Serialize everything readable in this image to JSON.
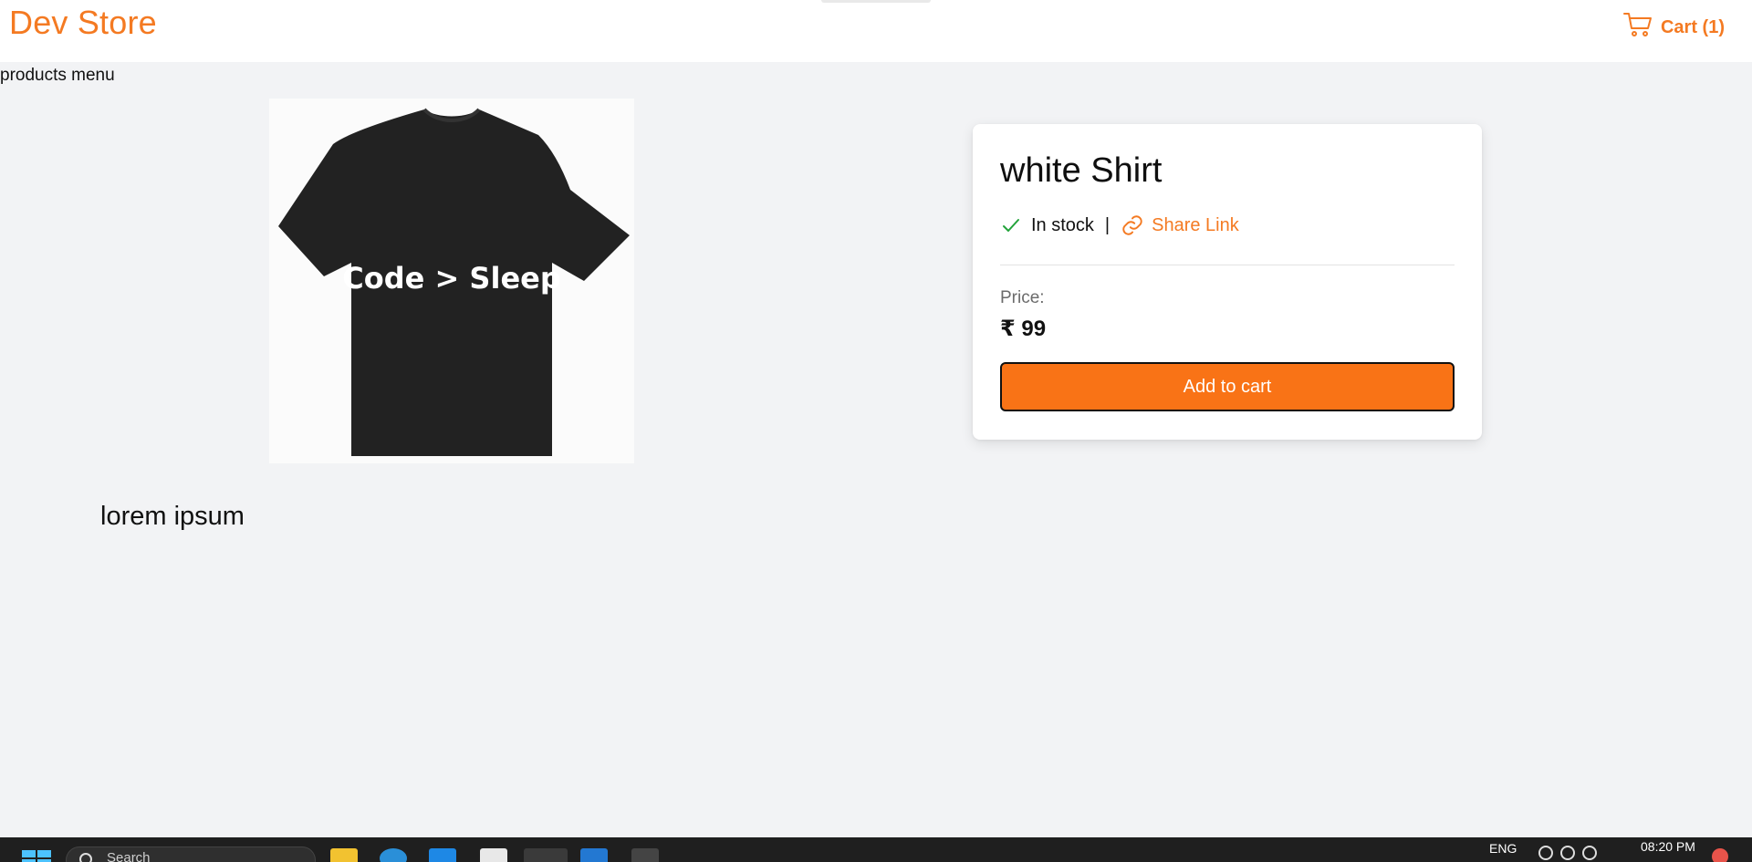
{
  "header": {
    "brand": "Dev Store",
    "cart_label": "Cart (1)",
    "cart_icon": "shopping-cart-icon",
    "accent_color": "#f47a22"
  },
  "nav": {
    "products_menu": "products menu"
  },
  "product": {
    "image_text": "Code > Sleep",
    "title": "white Shirt",
    "stock_status": "In stock",
    "separator": "|",
    "share_label": "Share Link",
    "price_label": "Price:",
    "price": "₹ 99",
    "add_to_cart_label": "Add to cart",
    "description": "lorem ipsum",
    "button_color": "#f97316",
    "stock_icon_color": "#22a33a"
  },
  "taskbar": {
    "search_placeholder": "Search",
    "language": "ENG",
    "time": "08:20 PM"
  }
}
